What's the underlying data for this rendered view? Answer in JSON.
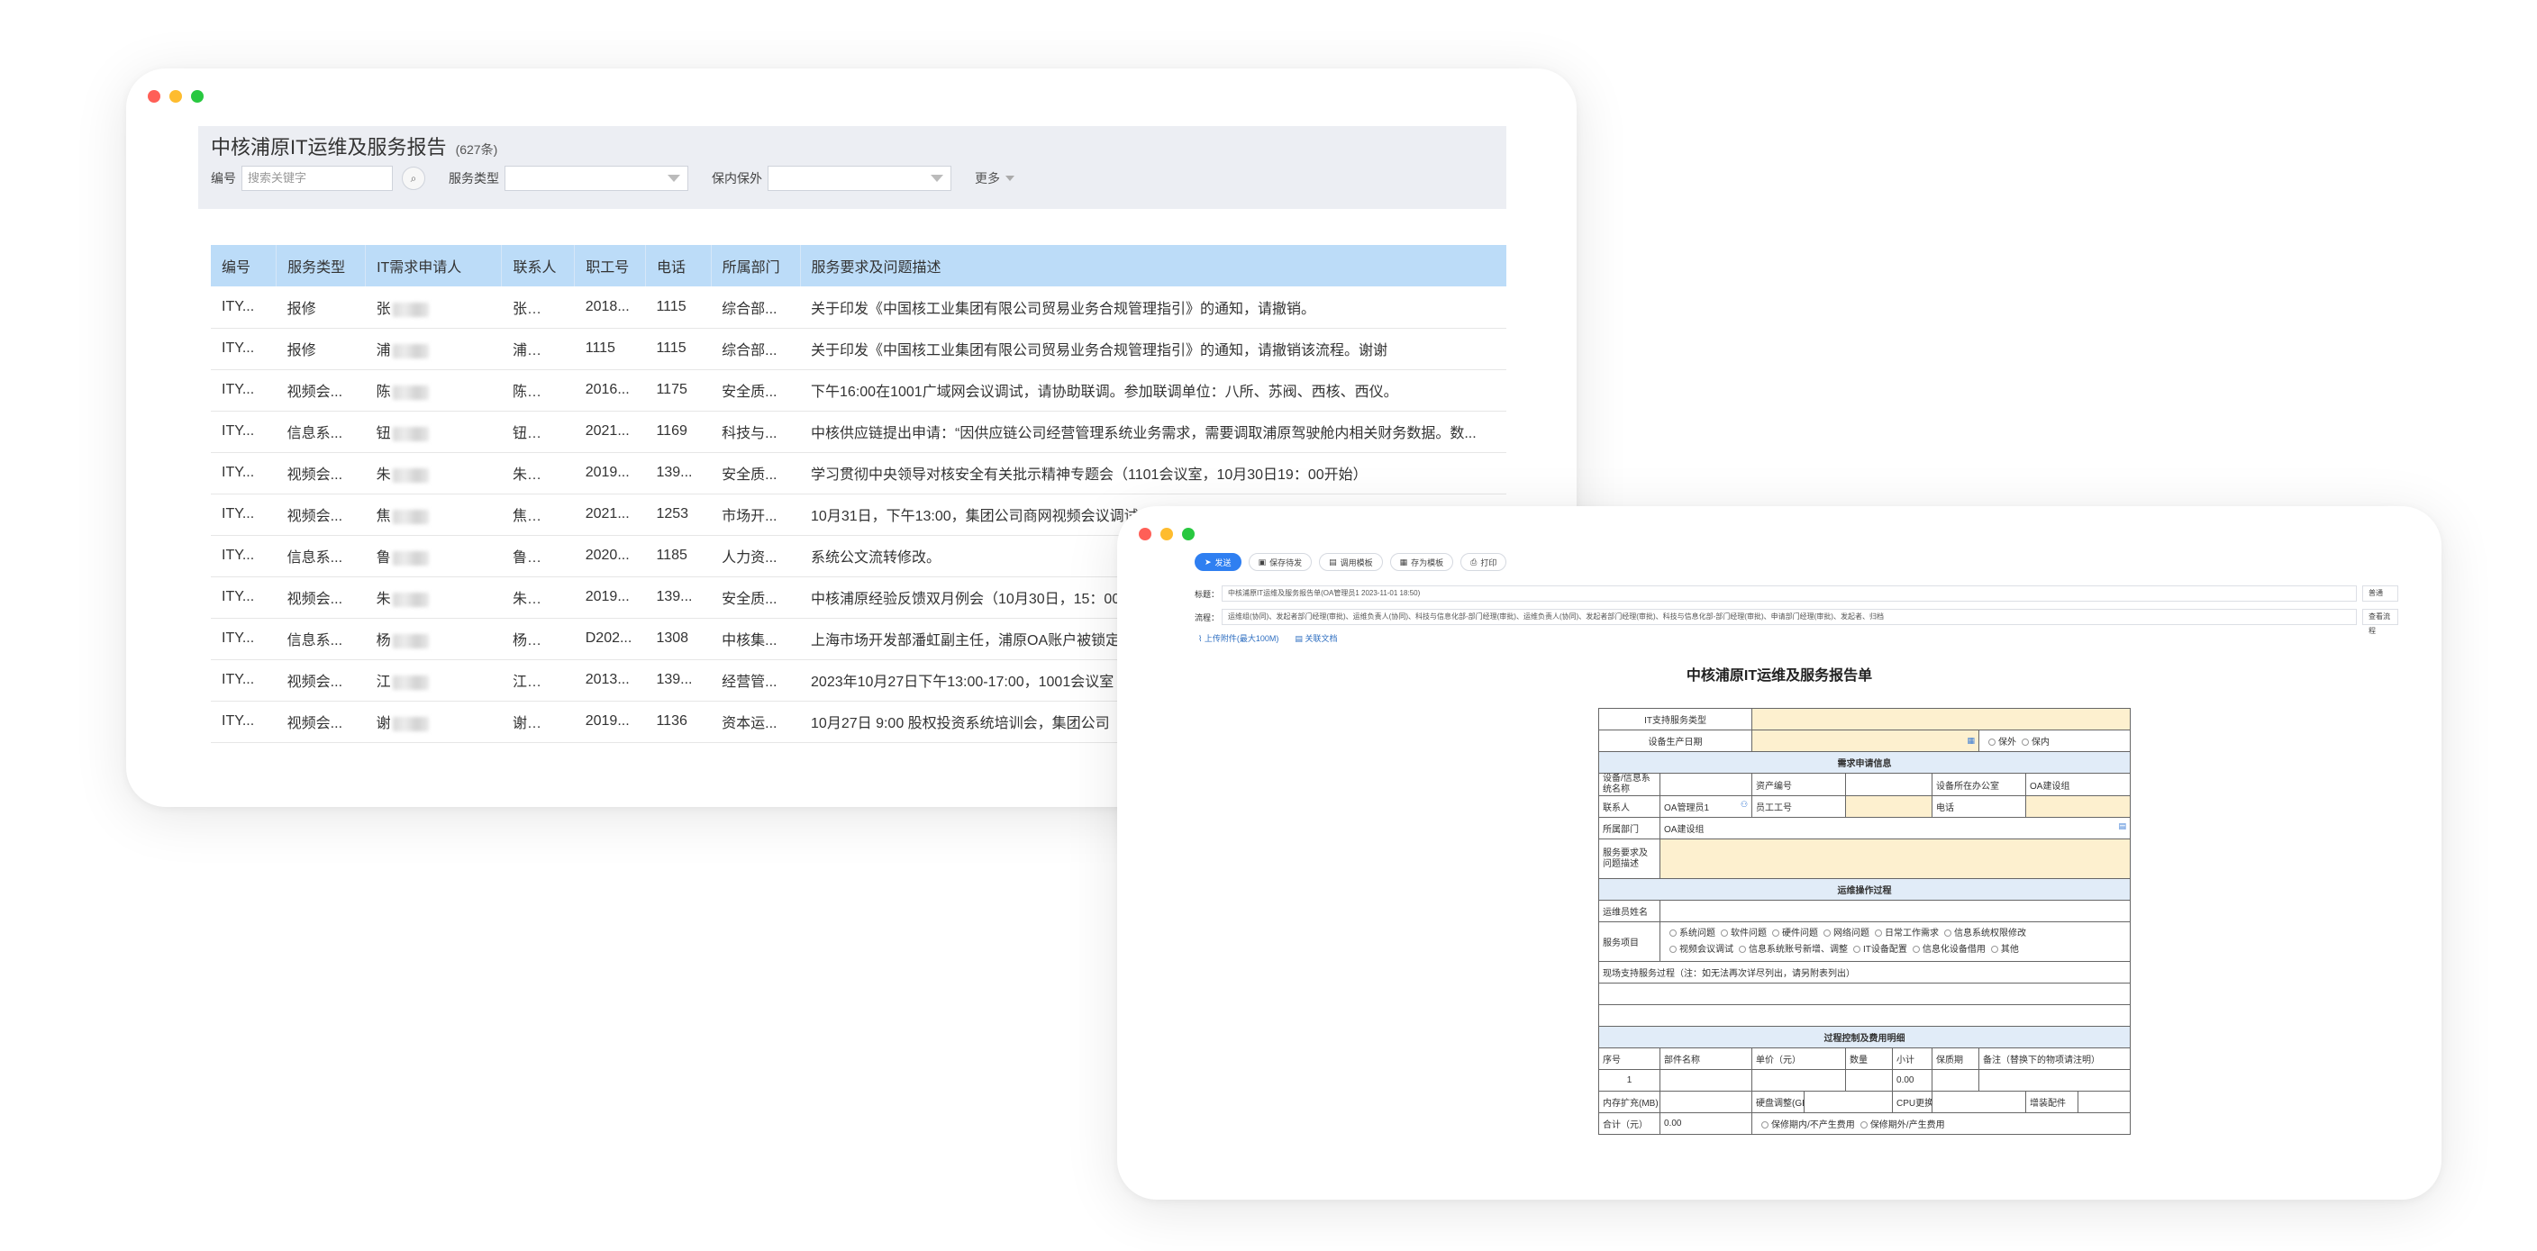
{
  "list": {
    "title": "中核浦原IT运维及服务报告",
    "count": "(627条)",
    "filters": {
      "code_label": "编号",
      "search_placeholder": "搜索关键字",
      "service_type_label": "服务类型",
      "warranty_label": "保内保外",
      "more_label": "更多"
    },
    "columns": [
      "编号",
      "服务类型",
      "IT需求申请人",
      "联系人",
      "职工号",
      "电话",
      "所属部门",
      "服务要求及问题描述"
    ],
    "rows": [
      {
        "code": "ITY...",
        "type": "报修",
        "applicant": "张",
        "contact": "张",
        "emp": "2018...",
        "phone": "1115",
        "dept": "综合部...",
        "desc": "关于印发《中国核工业集团有限公司贸易业务合规管理指引》的通知，请撤销。"
      },
      {
        "code": "ITY...",
        "type": "报修",
        "applicant": "浦",
        "contact": "浦",
        "emp": "1115",
        "phone": "1115",
        "dept": "综合部...",
        "desc": "关于印发《中国核工业集团有限公司贸易业务合规管理指引》的通知，请撤销该流程。谢谢"
      },
      {
        "code": "ITY...",
        "type": "视频会...",
        "applicant": "陈",
        "contact": "陈",
        "emp": "2016...",
        "phone": "1175",
        "dept": "安全质...",
        "desc": "下午16:00在1001广域网会议调试，请协助联调。参加联调单位：八所、苏阀、西核、西仪。"
      },
      {
        "code": "ITY...",
        "type": "信息系...",
        "applicant": "钮",
        "contact": "钮",
        "emp": "2021...",
        "phone": "1169",
        "dept": "科技与...",
        "desc": "中核供应链提出申请：“因供应链公司经营管理系统业务需求，需要调取浦原驾驶舱内相关财务数据。数..."
      },
      {
        "code": "ITY...",
        "type": "视频会...",
        "applicant": "朱",
        "contact": "朱",
        "emp": "2019...",
        "phone": "139...",
        "dept": "安全质...",
        "desc": "学习贯彻中央领导对核安全有关批示精神专题会（1101会议室，10月30日19：00开始）"
      },
      {
        "code": "ITY...",
        "type": "视频会...",
        "applicant": "焦",
        "contact": "焦",
        "emp": "2021...",
        "phone": "1253",
        "dept": "市场开...",
        "desc": "10月31日，下午13:00，集团公司商网视频会议调试"
      },
      {
        "code": "ITY...",
        "type": "信息系...",
        "applicant": "鲁",
        "contact": "鲁",
        "emp": "2020...",
        "phone": "1185",
        "dept": "人力资...",
        "desc": "系统公文流转修改。"
      },
      {
        "code": "ITY...",
        "type": "视频会...",
        "applicant": "朱",
        "contact": "朱",
        "emp": "2019...",
        "phone": "139...",
        "dept": "安全质...",
        "desc": "中核浦原经验反馈双月例会（10月30日，15：00"
      },
      {
        "code": "ITY...",
        "type": "信息系...",
        "applicant": "杨",
        "contact": "杨",
        "emp": "D202...",
        "phone": "1308",
        "dept": "中核集...",
        "desc": "上海市场开发部潘虹副主任，浦原OA账户被锁定"
      },
      {
        "code": "ITY...",
        "type": "视频会...",
        "applicant": "江",
        "contact": "江",
        "emp": "2013...",
        "phone": "139...",
        "dept": "经营管...",
        "desc": "2023年10月27日下午13:00-17:00，1001会议室"
      },
      {
        "code": "ITY...",
        "type": "视频会...",
        "applicant": "谢",
        "contact": "谢",
        "emp": "2019...",
        "phone": "1136",
        "dept": "资本运...",
        "desc": "10月27日 9:00 股权投资系统培训会，集团公司"
      }
    ]
  },
  "form": {
    "toolbar": {
      "send": "发送",
      "save_draft": "保存待发",
      "call_template": "调用模板",
      "save_template": "存为模板",
      "print": "打印"
    },
    "subject_label": "标题：",
    "subject_value": "中核浦原IT运维及服务报告单(OA管理员1 2023-11-01 18:50)",
    "subject_side": "普通",
    "flow_label": "流程：",
    "flow_value": "运维组(协同)、发起者部门经理(审批)、运维负责人(协同)、科技与信息化部-部门经理(审批)、运维负责人(协同)、发起者部门经理(审批)、科技与信息化部-部门经理(审批)、申请部门经理(审批)、发起者、归档",
    "flow_side": "查看流程",
    "attach_upload": "上传附件(最大100M)",
    "attach_link": "关联文档",
    "title": "中核浦原IT运维及服务报告单",
    "labels": {
      "it_service_type": "IT支持服务类型",
      "device_date": "设备生产日期",
      "warranty_out": "保外",
      "warranty_in": "保内",
      "request_section": "需求申请信息",
      "device_name": "设备/信息系统名称",
      "asset_no": "资产编号",
      "device_office": "设备所在办公室",
      "office_value": "OA建设组",
      "contact": "联系人",
      "contact_value": "OA管理员1",
      "emp_no": "员工工号",
      "phone": "电话",
      "dept": "所属部门",
      "dept_value": "OA建设组",
      "service_desc": "服务要求及问题描述",
      "ops_section": "运维操作过程",
      "ops_staff": "运维员姓名",
      "service_items": "服务项目",
      "items_row1": [
        "系统问题",
        "软件问题",
        "硬件问题",
        "网络问题",
        "日常工作需求",
        "信息系统权限修改"
      ],
      "items_row2": [
        "视频会议调试",
        "信息系统账号新增、调整",
        "IT设备配置",
        "信息化设备借用",
        "其他"
      ],
      "onsite_process": "现场支持服务过程（注：如无法再次详尽列出，请另附表列出）",
      "cost_section": "过程控制及费用明细",
      "cost_columns": [
        "序号",
        "部件名称",
        "单价（元）",
        "数量",
        "小计",
        "保质期",
        "备注（替换下的物项请注明）"
      ],
      "row_no": "1",
      "row_subtotal": "0.00",
      "memory": "内存扩充(MB)",
      "disk": "硬盘调整(GB)",
      "cpu": "CPU更换",
      "other_parts": "增装配件",
      "total": "合计（元）",
      "total_value": "0.00",
      "cost_in": "保修期内/不产生费用",
      "cost_out": "保修期外/产生费用"
    }
  }
}
